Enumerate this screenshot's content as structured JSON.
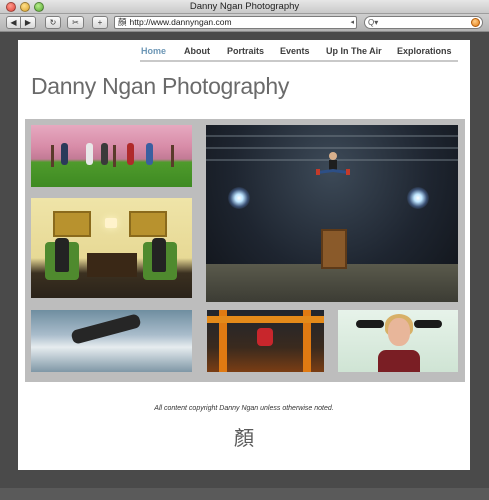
{
  "window": {
    "title": "Danny Ngan Photography"
  },
  "toolbar": {
    "back_icon": "◀",
    "forward_icon": "▶",
    "reload_icon": "↻",
    "snapback_icon": "✂",
    "add_icon": "+",
    "url": "http://www.dannyngan.com",
    "url_favicon": "顏",
    "search_placeholder": ""
  },
  "nav": {
    "items": [
      {
        "label": "Home",
        "active": true
      },
      {
        "label": "About"
      },
      {
        "label": "Portraits"
      },
      {
        "label": "Events"
      },
      {
        "label": "Up In The Air"
      },
      {
        "label": "Explorations"
      }
    ]
  },
  "site": {
    "title": "Danny Ngan Photography",
    "footer_text": "All content copyright Danny Ngan unless otherwise noted.",
    "footer_logo": "顏"
  },
  "colors": {
    "nav_active": "#6d97b6",
    "gallery_border": "#bdbdbd",
    "title_gray": "#6a6a6a"
  },
  "photos": [
    {
      "name": "photo-cherry-blossom-jump"
    },
    {
      "name": "photo-warehouse-jump"
    },
    {
      "name": "photo-green-chairs"
    },
    {
      "name": "photo-leaping-man-clouds"
    },
    {
      "name": "photo-orange-frame"
    },
    {
      "name": "photo-woman-portrait"
    }
  ]
}
